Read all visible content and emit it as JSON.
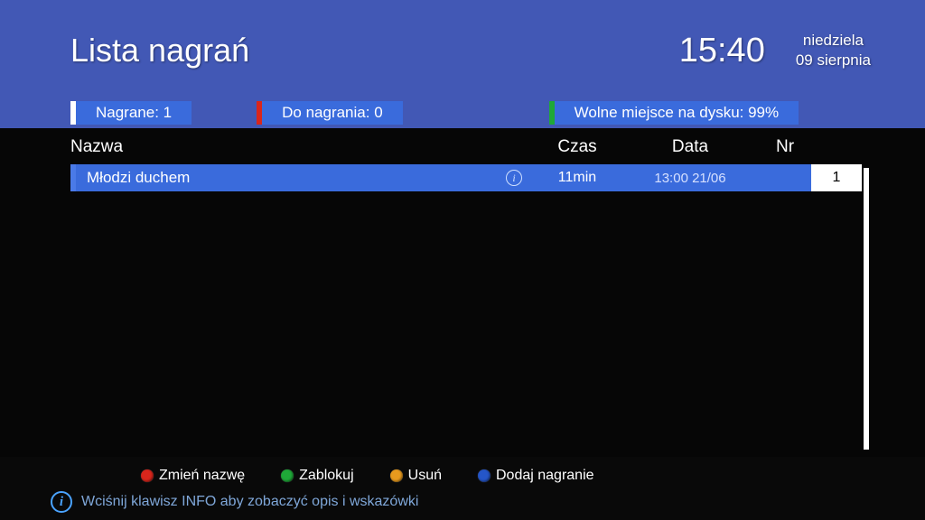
{
  "header": {
    "title": "Lista nagrań",
    "time": "15:40",
    "day": "niedziela",
    "date": "09 sierpnia"
  },
  "tabs": {
    "recorded": {
      "label": "Nagrane: 1",
      "marker": "#ffffff"
    },
    "to_record": {
      "label": "Do nagrania: 0",
      "marker": "#d9261c"
    },
    "free_space": {
      "label": "Wolne miejsce na dysku: 99%",
      "marker": "#1fa838"
    }
  },
  "columns": {
    "name": "Nazwa",
    "time": "Czas",
    "date": "Data",
    "nr": "Nr"
  },
  "rows": [
    {
      "name": "Młodzi duchem",
      "duration": "11min",
      "datetime": "13:00  21/06",
      "nr": "1"
    }
  ],
  "footer": {
    "actions": {
      "red": {
        "label": "Zmień nazwę",
        "color": "#d9261c"
      },
      "green": {
        "label": "Zablokuj",
        "color": "#1fa838"
      },
      "yellow": {
        "label": "Usuń",
        "color": "#e79a1e"
      },
      "blue": {
        "label": "Dodaj nagranie",
        "color": "#2556c9"
      }
    },
    "hint": "Wciśnij klawisz INFO aby zobaczyć opis i wskazówki"
  }
}
